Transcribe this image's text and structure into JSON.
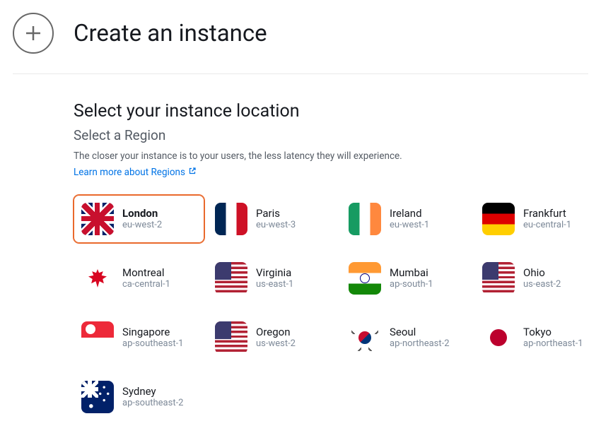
{
  "header": {
    "title": "Create an instance"
  },
  "location": {
    "title": "Select your instance location",
    "subtitle": "Select a Region",
    "help_text": "The closer your instance is to your users, the less latency they will experience.",
    "learn_link": "Learn more about Regions"
  },
  "regions": [
    {
      "name": "London",
      "code": "eu-west-2",
      "flag": "uk",
      "selected": true
    },
    {
      "name": "Paris",
      "code": "eu-west-3",
      "flag": "fr",
      "selected": false
    },
    {
      "name": "Ireland",
      "code": "eu-west-1",
      "flag": "ie",
      "selected": false
    },
    {
      "name": "Frankfurt",
      "code": "eu-central-1",
      "flag": "de",
      "selected": false
    },
    {
      "name": "Montreal",
      "code": "ca-central-1",
      "flag": "ca",
      "selected": false
    },
    {
      "name": "Virginia",
      "code": "us-east-1",
      "flag": "us",
      "selected": false
    },
    {
      "name": "Mumbai",
      "code": "ap-south-1",
      "flag": "in",
      "selected": false
    },
    {
      "name": "Ohio",
      "code": "us-east-2",
      "flag": "us",
      "selected": false
    },
    {
      "name": "Singapore",
      "code": "ap-southeast-1",
      "flag": "sg",
      "selected": false
    },
    {
      "name": "Oregon",
      "code": "us-west-2",
      "flag": "us",
      "selected": false
    },
    {
      "name": "Seoul",
      "code": "ap-northeast-2",
      "flag": "kr",
      "selected": false
    },
    {
      "name": "Tokyo",
      "code": "ap-northeast-1",
      "flag": "jp",
      "selected": false
    },
    {
      "name": "Sydney",
      "code": "ap-southeast-2",
      "flag": "au",
      "selected": false
    }
  ]
}
